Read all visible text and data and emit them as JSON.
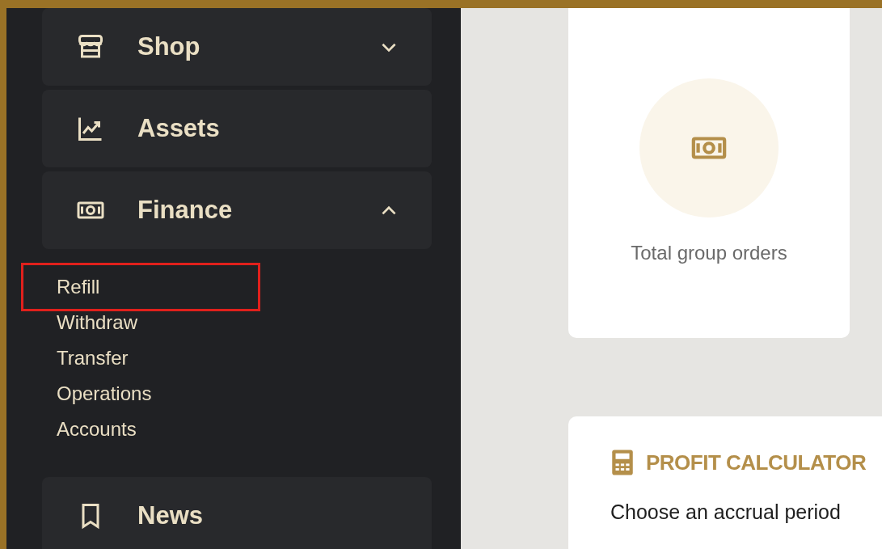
{
  "sidebar": {
    "items": [
      {
        "kind": "dropdown",
        "label": "Shop",
        "expanded": false
      },
      {
        "kind": "link",
        "label": "Assets"
      },
      {
        "kind": "dropdown",
        "label": "Finance",
        "expanded": true,
        "children": [
          {
            "label": "Refill",
            "selected": true
          },
          {
            "label": "Withdraw",
            "selected": false
          },
          {
            "label": "Transfer",
            "selected": false
          },
          {
            "label": "Operations",
            "selected": false
          },
          {
            "label": "Accounts",
            "selected": false
          }
        ]
      },
      {
        "kind": "link",
        "label": "News"
      }
    ]
  },
  "stat_card": {
    "label": "Total group orders"
  },
  "calculator": {
    "title": "PROFIT CALCULATOR",
    "subtitle": "Choose an accrual period"
  }
}
